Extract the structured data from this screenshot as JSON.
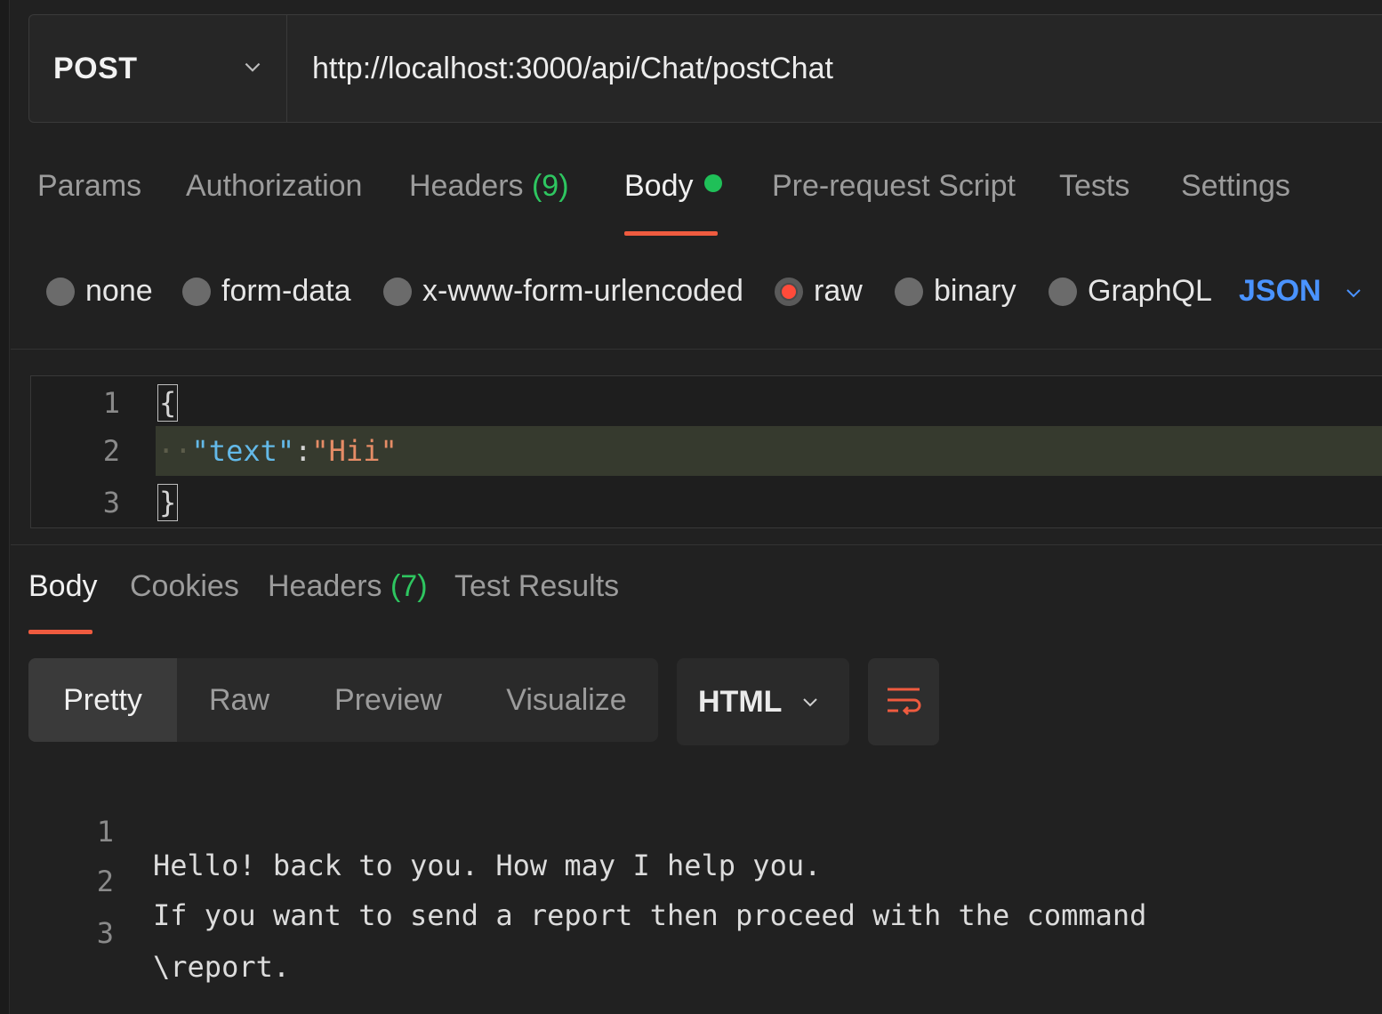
{
  "request": {
    "method": "POST",
    "url": "http://localhost:3000/api/Chat/postChat"
  },
  "request_tabs": {
    "params": "Params",
    "authorization": "Authorization",
    "headers": "Headers",
    "headers_count": "(9)",
    "body": "Body",
    "prerequest": "Pre-request Script",
    "tests": "Tests",
    "settings": "Settings",
    "active": "Body"
  },
  "body_types": {
    "options": [
      "none",
      "form-data",
      "x-www-form-urlencoded",
      "raw",
      "binary",
      "GraphQL"
    ],
    "selected": "raw",
    "language": "JSON"
  },
  "request_body": {
    "line_numbers": [
      "1",
      "2",
      "3"
    ],
    "open_brace": "{",
    "key": "\"text\"",
    "colon": ":",
    "value": "\"Hii\"",
    "close_brace": "}"
  },
  "response_tabs": {
    "body": "Body",
    "cookies": "Cookies",
    "headers": "Headers",
    "headers_count": "(7)",
    "test_results": "Test Results",
    "active": "Body"
  },
  "response_view": {
    "modes": [
      "Pretty",
      "Raw",
      "Preview",
      "Visualize"
    ],
    "active": "Pretty",
    "format": "HTML"
  },
  "response_body": {
    "lines": [
      {
        "n": "1",
        "text": "Hello! back to you. How may I help you."
      },
      {
        "n": "2",
        "text": "If you want to send a report then proceed with the command"
      },
      {
        "n": "3",
        "text": "\\report."
      }
    ]
  },
  "colors": {
    "accent_underline": "#ef5b3f",
    "count_green": "#2ec660",
    "language_blue": "#4a93ff",
    "radio_selected": "#ff4b3a"
  }
}
